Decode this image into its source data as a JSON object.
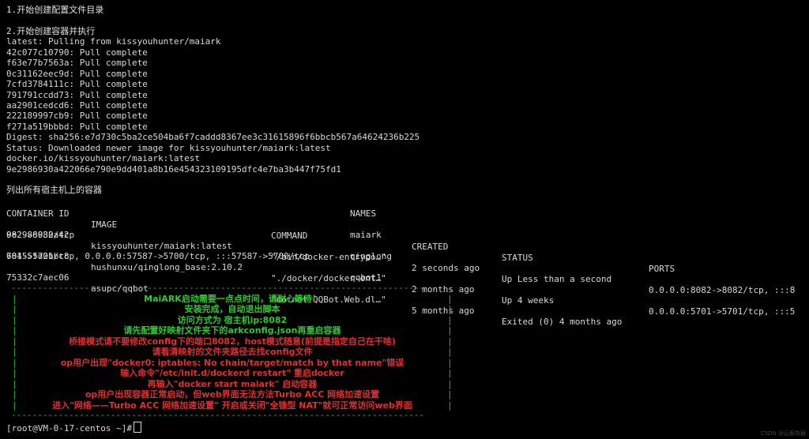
{
  "terminal": {
    "step1": "1.开始创建配置文件目录",
    "step2": "2.开始创建容器并执行",
    "pull_lines": [
      "latest: Pulling from kissyouhunter/maiark",
      "42c077c10790: Pull complete",
      "f63e77b7563a: Pull complete",
      "0c31162eec9d: Pull complete",
      "7cfd3784111c: Pull complete",
      "791791ccdd73: Pull complete",
      "aa2901cedcd6: Pull complete",
      "222189997cb9: Pull complete",
      "f271a519bbbd: Pull complete",
      "Digest: sha256:e7d730c5ba2ce504ba6f7caddd8367ee3c31615896f6bbcb567a64624236b225",
      "Status: Downloaded newer image for kissyouhunter/maiark:latest",
      "docker.io/kissyouhunter/maiark:latest",
      "9e2986930a422066e790e9dd401a8b16e454323109195dfc4e7ba3b447f75fd1"
    ],
    "step3": "列出所有宿主机上的容器",
    "table": {
      "headers": {
        "container_id": "CONTAINER ID",
        "image": "IMAGE",
        "command": "COMMAND",
        "created": "CREATED",
        "status": "STATUS",
        "ports": "PORTS",
        "names": "NAMES"
      },
      "rows": [
        {
          "container_id": "9e2986930a42",
          "image": "kissyouhunter/maiark:latest",
          "command": "\"/bin/docker-entrypo…\"",
          "created": "2 seconds ago",
          "status": "Up Less than a second",
          "ports": "0.0.0.0:8082->8082/tcp, :::8",
          "ports_wrap": "082->8082/tcp",
          "name": "maiark"
        },
        {
          "container_id": "68455fd2bbc8",
          "image": "hushunxu/qinglong_base:2.10.2",
          "command": "\"./docker/docker-ent…\"",
          "created": "2 months ago",
          "status": "Up 4 weeks",
          "ports": "0.0.0.0:5701->5701/tcp, :::5",
          "ports_wrap": "701->5701/tcp, 0.0.0.0:57587->5700/tcp, :::57587->5700/tcp",
          "name": "qinglong"
        },
        {
          "container_id": "75332c7aec06",
          "image": "asupc/qqbot",
          "command": "\"dotnet QQBot.Web.dl…\"",
          "created": "5 months ago",
          "status": "Exited (0) 4 months ago",
          "ports": "",
          "ports_wrap": "",
          "name": "qqbot1"
        }
      ]
    },
    "banner": {
      "border_dashes": "-------------------------------------------------------------------------------",
      "lines": [
        {
          "text": "MaiARK启动需要一点点时间，请耐心等待！",
          "color": "green"
        },
        {
          "text": "安装完成，自动退出脚本",
          "color": "green"
        },
        {
          "text": "访问方式为 宿主机ip:8082",
          "color": "green"
        },
        {
          "text": "请先配置好映射文件夹下的arkconfig.json再重启容器",
          "color": "green"
        },
        {
          "text": "桥接模式请不要修改config下的端口8082，host模式随意(前提是指定自己在干啥)",
          "color": "red"
        },
        {
          "text": "请看清映射的文件夹路径去找config文件",
          "color": "red"
        },
        {
          "text": "op用户出现\"docker0: iptables: No chain/target/match by that name\"错误",
          "color": "red"
        },
        {
          "text": "输入命令\"/etc/init.d/dockerd restart\" 重启docker",
          "color": "red"
        },
        {
          "text": "再输入\"docker start maiark\" 启动容器",
          "color": "red"
        },
        {
          "text": "op用户出现容器正常启动，但web界面无法方法Turbo ACC 网络加速设置",
          "color": "red"
        },
        {
          "text": "进入\"网络——Turbo ACC 网络加速设置\" 开启或关闭\"全锥型 NAT\"就可正常访问web界面",
          "color": "red"
        }
      ]
    },
    "prompt": "[root@VM-0-17-centos ~]#",
    "watermark": "CSDN @云服务器"
  }
}
